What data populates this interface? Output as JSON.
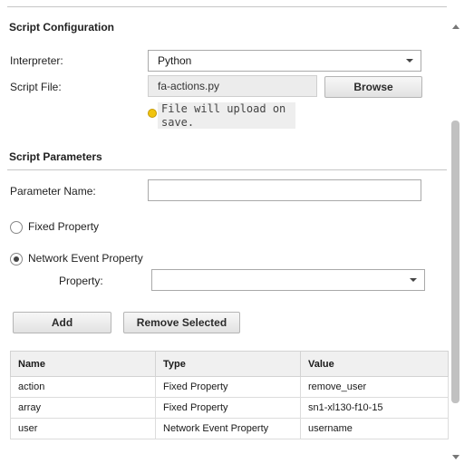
{
  "script_configuration": {
    "title": "Script Configuration",
    "interpreter_label": "Interpreter:",
    "interpreter_value": "Python",
    "script_file_label": "Script File:",
    "script_file_value": "fa-actions.py",
    "browse_label": "Browse",
    "upload_note_line1": "File will upload on",
    "upload_note_line2": "save."
  },
  "script_parameters": {
    "title": "Script Parameters",
    "parameter_name_label": "Parameter Name:",
    "parameter_name_value": "",
    "fixed_property_label": "Fixed Property",
    "network_event_property_label": "Network Event Property",
    "selected_option": "Network Event Property",
    "property_label": "Property:",
    "property_value": "",
    "add_label": "Add",
    "remove_selected_label": "Remove Selected"
  },
  "table": {
    "headers": [
      "Name",
      "Type",
      "Value"
    ],
    "rows": [
      [
        "action",
        "Fixed Property",
        "remove_user"
      ],
      [
        "array",
        "Fixed Property",
        "sn1-xl130-f10-15"
      ],
      [
        "user",
        "Network Event Property",
        "username"
      ]
    ]
  },
  "icons": {
    "info": "info-dot-icon",
    "dropdown": "chevron-down-icon",
    "scroll_up": "scroll-up-arrow-icon",
    "scroll_down": "scroll-down-arrow-icon"
  },
  "colors": {
    "info_dot": "#f1c40f",
    "header_bg": "#f0f0f0",
    "readonly_bg": "#ececec"
  }
}
